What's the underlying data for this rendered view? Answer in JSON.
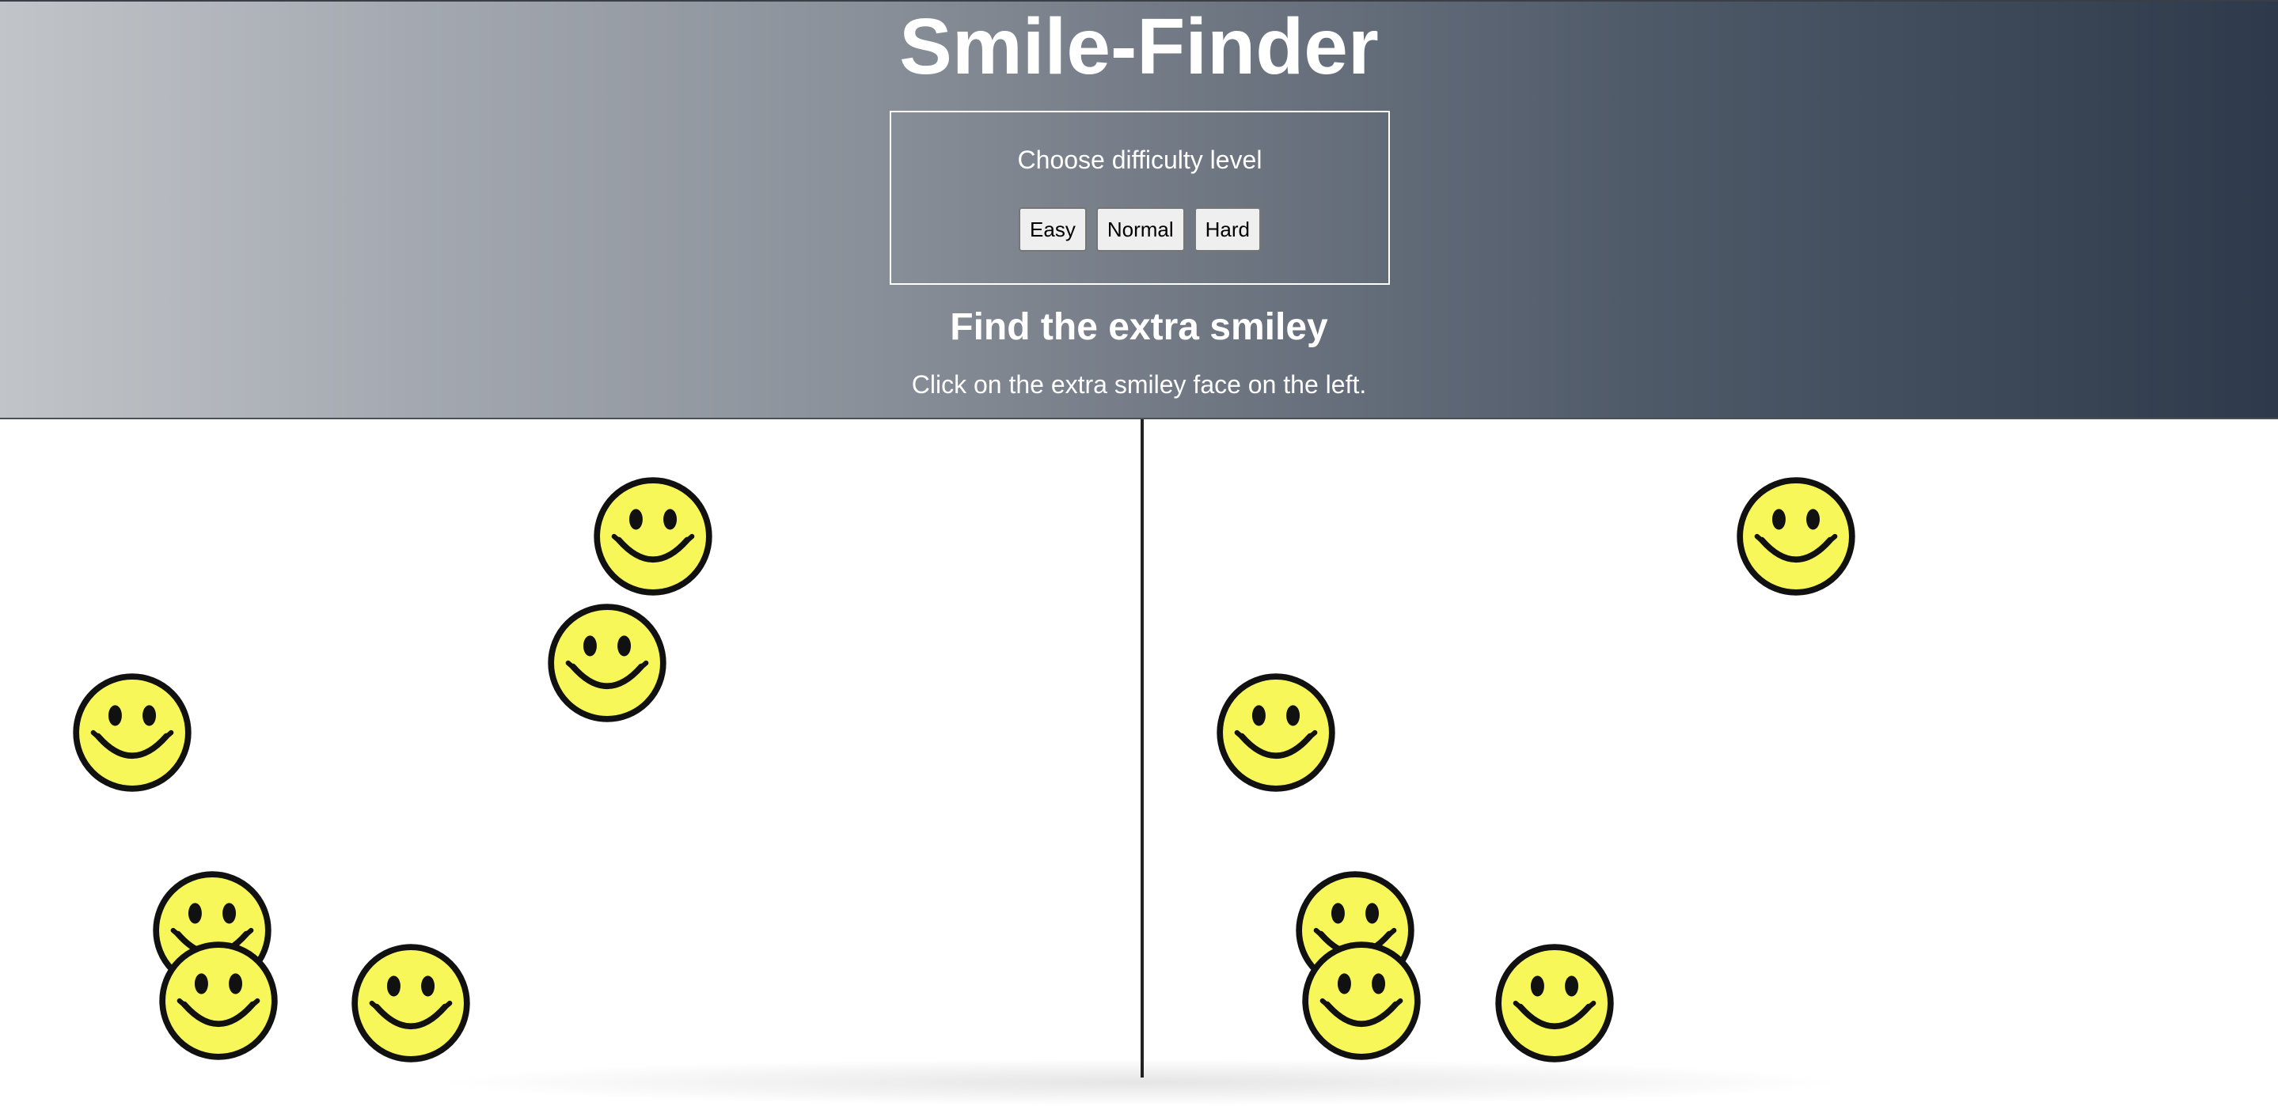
{
  "header": {
    "title": "Smile-Finder",
    "difficulty": {
      "label": "Choose difficulty level",
      "buttons": [
        "Easy",
        "Normal",
        "Hard"
      ]
    },
    "instruction_heading": "Find the extra smiley",
    "instruction_text": "Click on the extra smiley face on the left."
  },
  "game": {
    "icon": "smiley-face-icon",
    "left_smiley_count": 6,
    "right_smiley_count": 5
  },
  "colors": {
    "smiley_fill": "#f8f75a",
    "smiley_stroke": "#111111",
    "header_gradient_start": "#c1c5c9",
    "header_gradient_end": "#2e3a4b"
  }
}
